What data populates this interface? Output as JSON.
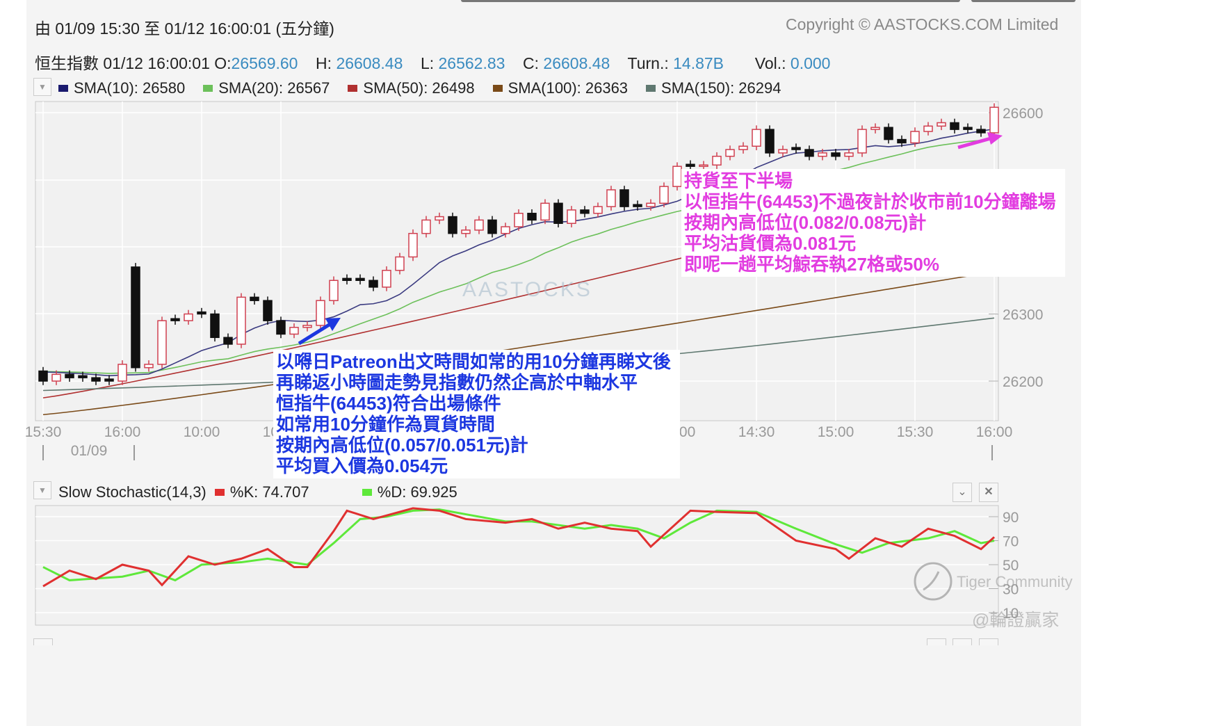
{
  "header": {
    "range_label": "由  01/09 15:30 至  01/12 16:00:01 (五分鐘)",
    "copyright": "Copyright © AASTOCKS.COM Limited",
    "quote": {
      "name_time": "恒生指數 01/12 16:00:01",
      "open_label": "O:",
      "open": "26569.60",
      "high_label": "H:",
      "high": "26608.48",
      "low_label": "L:",
      "low": "26562.83",
      "close_label": "C:",
      "close": "26608.48",
      "turn_label": "Turn.:",
      "turn": "14.87B",
      "vol_label": "Vol.:",
      "vol": "0.000"
    }
  },
  "legend": [
    {
      "label": "SMA(10): 26580",
      "color": "#1a1a6e"
    },
    {
      "label": "SMA(20): 26567",
      "color": "#6cc05a"
    },
    {
      "label": "SMA(50): 26498",
      "color": "#b03030"
    },
    {
      "label": "SMA(100): 26363",
      "color": "#7a4a18"
    },
    {
      "label": "SMA(150): 26294",
      "color": "#5f7870"
    }
  ],
  "stoch_legend": {
    "title": "Slow Stochastic(14,3)",
    "k": "%K: 74.707",
    "d": "%D: 69.925",
    "k_color": "#e03030",
    "d_color": "#5ee83a"
  },
  "watermarks": {
    "center": "AASTOCKS",
    "tiger": "Tiger Community",
    "author": "@輪證贏家"
  },
  "annotations": {
    "blue": [
      "以嘚日Patreon出文時間如常的用10分鐘再睇文後",
      "再睇返小時圖走勢見指數仍然企高於中軸水平",
      "恒指牛(64453)符合出場條件",
      "如常用10分鐘作為買貨時間",
      "按期內高低位(0.057/0.051元)計",
      "平均買入價為0.054元"
    ],
    "pink": [
      "持貨至下半場",
      "以恒指牛(64453)不過夜計於收市前10分鐘離場",
      "按期內高低位(0.082/0.08元)計",
      "平均沽貨價為0.081元",
      "即呢一趟平均鯨吞執27格或50%"
    ]
  },
  "chart_data": [
    {
      "type": "candlestick",
      "title": "恒生指數 5-min",
      "ylim": [
        26160,
        26620
      ],
      "yticks": [
        "26600",
        "26300",
        "26200"
      ],
      "xticks": [
        {
          "i": 0,
          "label": "15:30"
        },
        {
          "i": 6,
          "label": "16:00"
        },
        {
          "i": 12,
          "label": "10:00"
        },
        {
          "i": 18,
          "label": "10:30"
        },
        {
          "i": 48,
          "label": "14:00"
        },
        {
          "i": 54,
          "label": "14:30"
        },
        {
          "i": 60,
          "label": "15:00"
        },
        {
          "i": 66,
          "label": "15:30"
        },
        {
          "i": 72,
          "label": "16:00"
        }
      ],
      "date_label": "01/09",
      "closes": [
        26200,
        26210,
        26205,
        26205,
        26200,
        26200,
        26225,
        26220,
        26225,
        26290,
        26290,
        26300,
        26300,
        26265,
        26255,
        26325,
        26320,
        26290,
        26270,
        26280,
        26283,
        26320,
        26350,
        26350,
        26350,
        26340,
        26365,
        26385,
        26420,
        26440,
        26445,
        26420,
        26425,
        26440,
        26420,
        26430,
        26450,
        26440,
        26465,
        26435,
        26455,
        26450,
        26460,
        26485,
        26460,
        26460,
        26465,
        26490,
        26520,
        26520,
        26522,
        26535,
        26545,
        26550,
        26575,
        26540,
        26545,
        26545,
        26535,
        26540,
        26535,
        26540,
        26575,
        26578,
        26560,
        26555,
        26572,
        26580,
        26585,
        26575,
        26575,
        26570,
        26608
      ],
      "special_open": {
        "7": 26370
      },
      "long_sma": [
        {
          "name": "SMA(50)",
          "from": 26175,
          "to": 26498
        },
        {
          "name": "SMA(100)",
          "from": 26150,
          "to": 26363
        },
        {
          "name": "SMA(150)",
          "from": 26186,
          "to": 26294
        }
      ]
    },
    {
      "type": "line",
      "title": "Slow Stochastic(14,3)",
      "ylim": [
        0,
        100
      ],
      "yticks": [
        "90",
        "70",
        "50",
        "30",
        "10"
      ],
      "k": [
        [
          0,
          32
        ],
        [
          2,
          45
        ],
        [
          4,
          38
        ],
        [
          6,
          50
        ],
        [
          8,
          45
        ],
        [
          9,
          33
        ],
        [
          11,
          57
        ],
        [
          13,
          50
        ],
        [
          15,
          55
        ],
        [
          17,
          63
        ],
        [
          19,
          48
        ],
        [
          20,
          48
        ],
        [
          22,
          78
        ],
        [
          23,
          95
        ],
        [
          25,
          88
        ],
        [
          28,
          97
        ],
        [
          30,
          95
        ],
        [
          32,
          88
        ],
        [
          35,
          85
        ],
        [
          37,
          88
        ],
        [
          39,
          80
        ],
        [
          41,
          85
        ],
        [
          43,
          80
        ],
        [
          45,
          78
        ],
        [
          46,
          65
        ],
        [
          49,
          95
        ],
        [
          51,
          94
        ],
        [
          54,
          93
        ],
        [
          57,
          70
        ],
        [
          60,
          63
        ],
        [
          61,
          55
        ],
        [
          63,
          72
        ],
        [
          65,
          65
        ],
        [
          67,
          80
        ],
        [
          69,
          74
        ],
        [
          71,
          63
        ],
        [
          72,
          73
        ]
      ],
      "d": [
        [
          0,
          48
        ],
        [
          2,
          37
        ],
        [
          6,
          40
        ],
        [
          8,
          45
        ],
        [
          10,
          37
        ],
        [
          12,
          50
        ],
        [
          15,
          52
        ],
        [
          17,
          55
        ],
        [
          20,
          50
        ],
        [
          22,
          68
        ],
        [
          24,
          88
        ],
        [
          26,
          90
        ],
        [
          28,
          95
        ],
        [
          30,
          96
        ],
        [
          32,
          92
        ],
        [
          35,
          86
        ],
        [
          37,
          86
        ],
        [
          39,
          83
        ],
        [
          41,
          80
        ],
        [
          43,
          83
        ],
        [
          45,
          80
        ],
        [
          47,
          72
        ],
        [
          49,
          85
        ],
        [
          51,
          95
        ],
        [
          54,
          94
        ],
        [
          57,
          80
        ],
        [
          60,
          67
        ],
        [
          62,
          60
        ],
        [
          64,
          68
        ],
        [
          67,
          72
        ],
        [
          69,
          78
        ],
        [
          71,
          68
        ],
        [
          72,
          70
        ]
      ]
    }
  ]
}
